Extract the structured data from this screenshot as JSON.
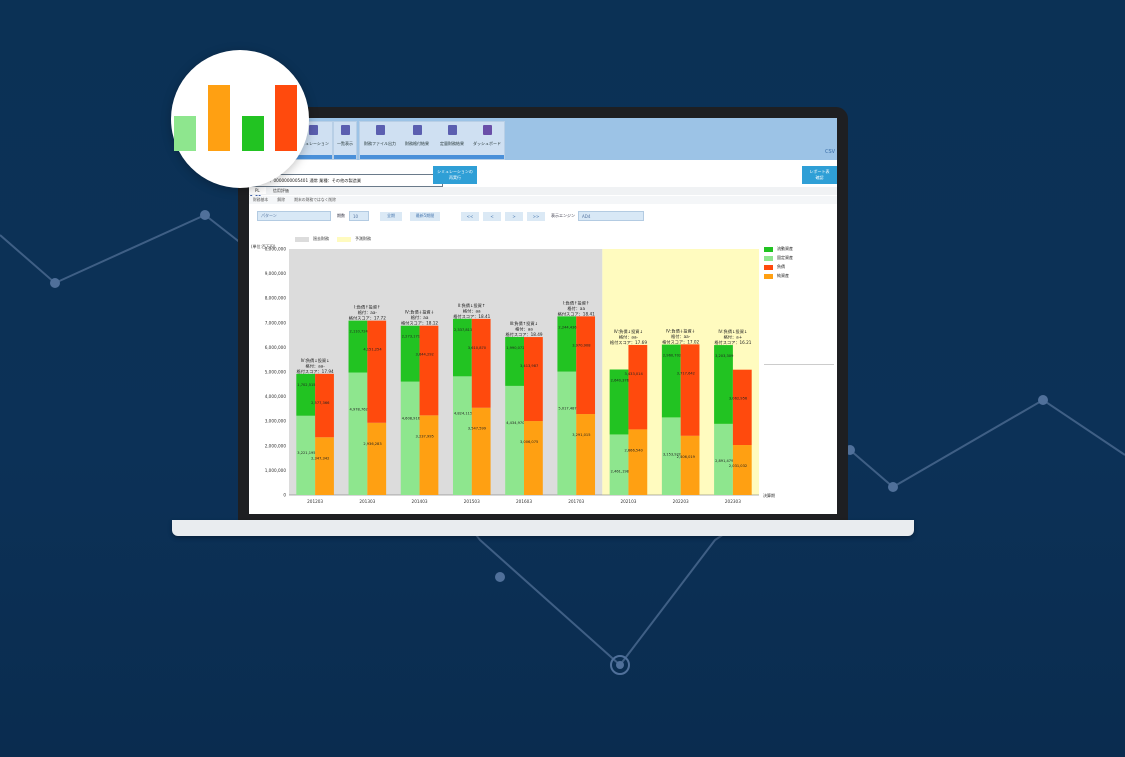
{
  "ribbon": {
    "buttons": [
      "シミュレーション",
      "一覧表示",
      "財務ファイル出力",
      "財務格付結果",
      "定量財務結果",
      "ダッシュボード"
    ]
  },
  "header": {
    "company_info": "500 CSF：0000000005401 通常 業種：その他の製造業",
    "simulation_button": "シミュレーションの\n再実行",
    "report_button": "レポート表\n確認",
    "right_label": "CSV",
    "left_fragment": "AI"
  },
  "tabs": [
    "PL",
    "信用評価"
  ],
  "subtabs": [
    "財務基本",
    "解除",
    "期末の財務ではなく削除"
  ],
  "controls": {
    "pattern_placeholder": "パターン",
    "period_label": "期数",
    "period_value": "10",
    "all_button": "全期",
    "recent_button": "最新5期間",
    "nav": [
      "<<",
      "<",
      "> ",
      ">>"
    ],
    "display_label": "表示エンジン",
    "display_value": "AD4"
  },
  "colors": {
    "current_assets": "#22c322",
    "fixed_assets": "#8ee68e",
    "liabilities": "#ff4a0d",
    "equity": "#ffa012",
    "past_band": "#dcdcdc",
    "forecast_band": "#fffbbf"
  },
  "chart_data": {
    "type": "bar",
    "stacked": true,
    "top_legend": [
      "過去財務",
      "予測財務"
    ],
    "ylabel": "(単位:百万円)",
    "xlabel": "決算期",
    "ylim": [
      0,
      10000000
    ],
    "yticks": [
      "0",
      "1,000,000",
      "2,000,000",
      "3,000,000",
      "4,000,000",
      "5,000,000",
      "6,000,000",
      "7,000,000",
      "8,000,000",
      "9,000,000",
      "0,000,000"
    ],
    "categories": [
      "201203",
      "201303",
      "201403",
      "201503",
      "201603",
      "201703",
      "202103",
      "202203",
      "202303"
    ],
    "forecast_from_index": 6,
    "legend": [
      "流動資産",
      "固定資産",
      "負債",
      "純資産"
    ],
    "assets_series": [
      {
        "name": "固定資産",
        "values": [
          3221195,
          4978762,
          4608916,
          4824115,
          4434970,
          5017487,
          2461198,
          3153920,
          2891479
        ]
      },
      {
        "name": "流動資産",
        "values": [
          1702515,
          2110724,
          2273171,
          2337813,
          1990072,
          2244436,
          2640376,
          2960702,
          3203309
        ]
      }
    ],
    "liab_series": [
      {
        "name": "純資産",
        "values": [
          2347342,
          2936283,
          3237995,
          3547599,
          3006075,
          3291015,
          2666540,
          2406019,
          2031032
        ]
      },
      {
        "name": "負債",
        "values": [
          2577366,
          4151254,
          3644292,
          3610870,
          3413987,
          3970908,
          3433014,
          3717642,
          3062956
        ]
      }
    ],
    "annotations": [
      [
        "Ⅳ:負債↓投資↓",
        "格付：aa-",
        "格付スコア：17.94"
      ],
      [
        "Ⅰ:負債↑投資↑",
        "格付：aa-",
        "格付スコア：17.72"
      ],
      [
        "Ⅳ:負債↓投資↓",
        "格付：aa",
        "格付スコア：18.12"
      ],
      [
        "Ⅱ:負債↓投資↑",
        "格付：aa",
        "格付スコア：18.41"
      ],
      [
        "Ⅲ:負債↑投資↓",
        "格付：aa",
        "格付スコア：18.49"
      ],
      [
        "Ⅰ:負債↑投資↑",
        "格付：aa",
        "格付スコア：18.41"
      ],
      [
        "Ⅳ:負債↓投資↓",
        "格付：aa-",
        "格付スコア：17.69"
      ],
      [
        "Ⅳ:負債↓投資↓",
        "格付：aa-",
        "格付スコア：17.02"
      ],
      [
        "Ⅳ:負債↓投資↓",
        "格付：a+",
        "格付スコア：16.21"
      ]
    ]
  }
}
